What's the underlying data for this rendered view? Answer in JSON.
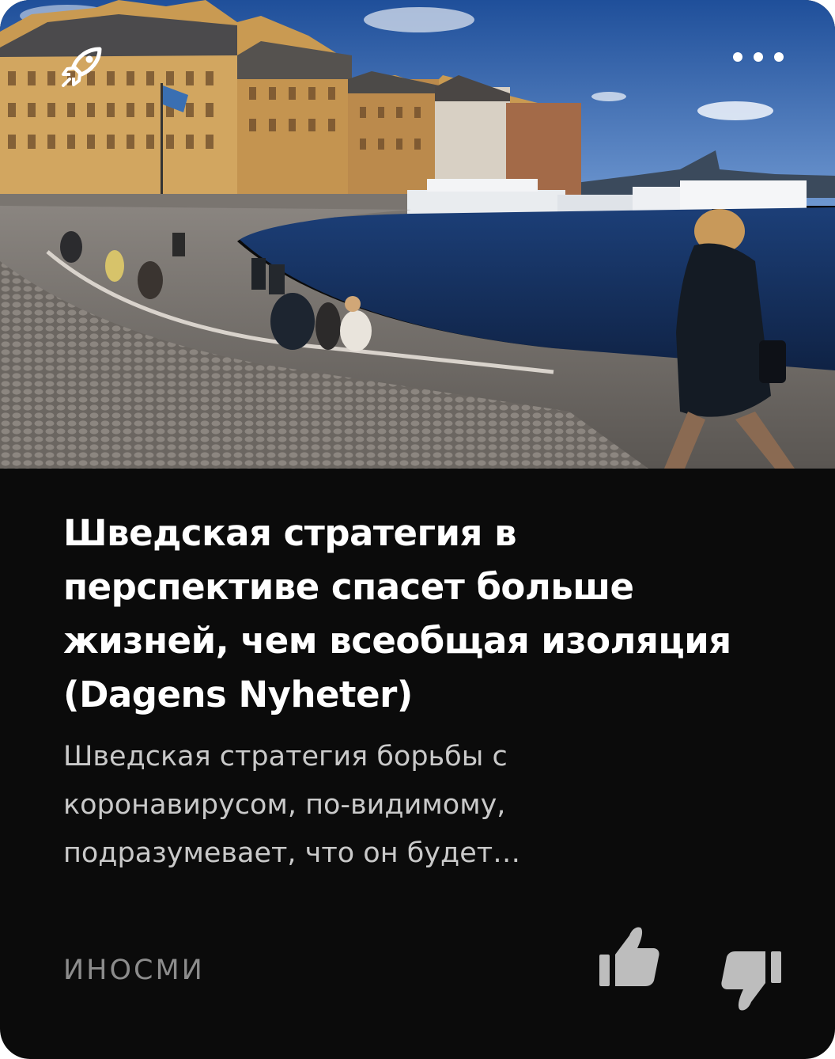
{
  "article": {
    "title": "Шведская стратегия в перспективе спасет больше жизней, чем всеобщая изоляция (Dagens Nyheter)",
    "snippet": "Шведская стратегия борьбы с коронавирусом, по-видимому, подразумевает, что он будет…",
    "source": "ИНОСМИ"
  },
  "icons": {
    "source_logo": "rocket-icon",
    "menu": "more-dots-icon",
    "like": "thumbs-up-icon",
    "dislike": "thumbs-down-icon"
  },
  "colors": {
    "card_background": "#0b0b0b",
    "title": "#ffffff",
    "snippet": "#c9c9c9",
    "source": "#8c8c8c",
    "icons": "#bdbdbd"
  }
}
